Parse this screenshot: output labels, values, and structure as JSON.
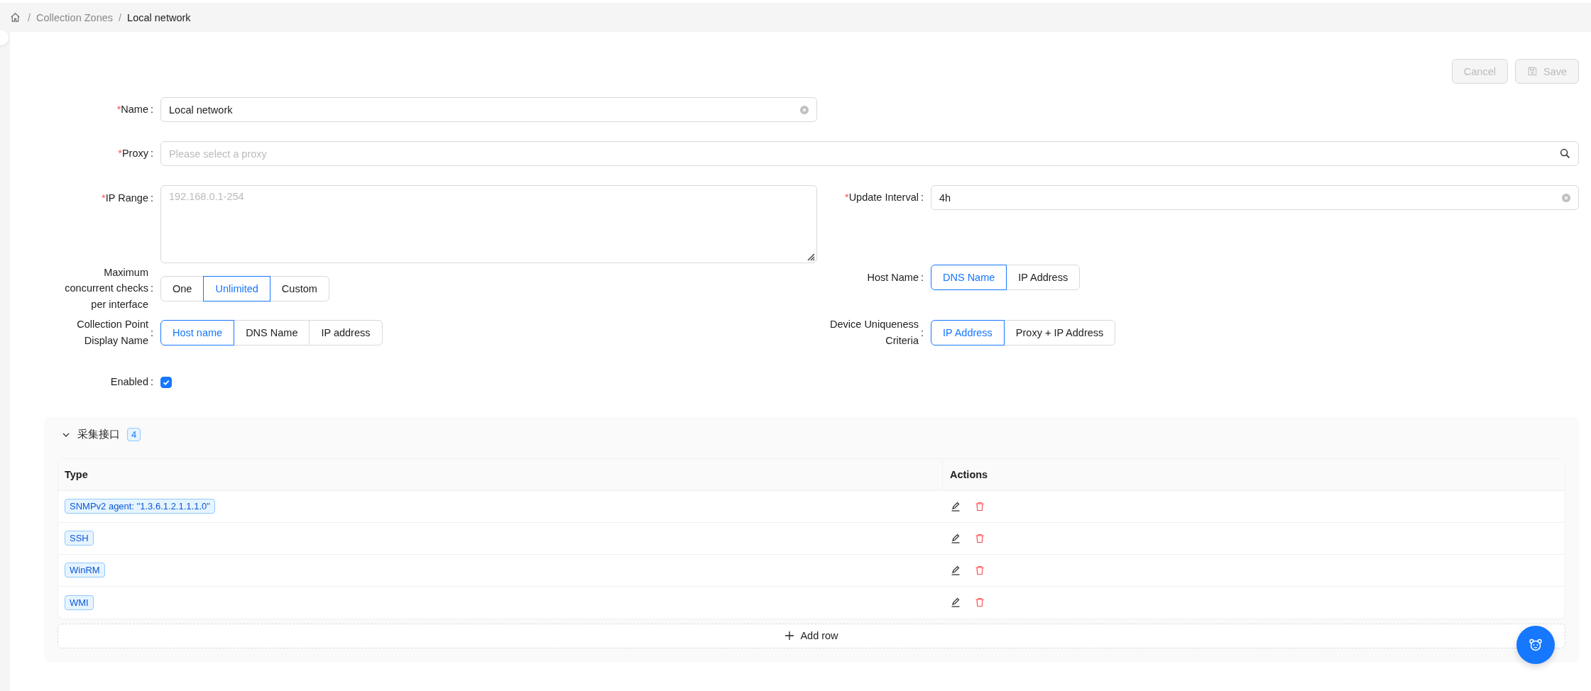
{
  "breadcrumb": [
    {
      "label": "Collection Zones",
      "current": false
    },
    {
      "label": "Local network",
      "current": true
    }
  ],
  "breadcrumb_separator": "/",
  "toolbar": [
    {
      "kind": "cancel",
      "label": "Cancel",
      "disabled": true
    },
    {
      "kind": "save",
      "label": "Save",
      "disabled": true
    }
  ],
  "form": {
    "required_mark": "*",
    "label_suffix": ":",
    "rows": [
      {
        "fields": [
          {
            "kind": "text",
            "label": "Name",
            "required": true,
            "value": "Local network",
            "clearable": true
          }
        ]
      },
      {
        "full": true,
        "fields": [
          {
            "kind": "search",
            "label": "Proxy",
            "required": true,
            "placeholder": "Please select a proxy"
          }
        ]
      },
      {
        "fields": [
          {
            "kind": "textarea",
            "label": "IP Range",
            "required": true,
            "placeholder": "192.168.0.1-254"
          },
          {
            "kind": "text",
            "label": "Update Interval",
            "required": true,
            "value": "4h",
            "clearable": true
          }
        ]
      },
      {
        "fields": [
          {
            "kind": "segmented",
            "label": "Maximum concurrent checks per interface",
            "required": false,
            "options": [
              {
                "label": "One",
                "selected": false
              },
              {
                "label": "Unlimited",
                "selected": true
              },
              {
                "label": "Custom",
                "selected": false
              }
            ]
          },
          {
            "kind": "segmented",
            "label": "Host Name",
            "required": false,
            "options": [
              {
                "label": "DNS Name",
                "selected": true
              },
              {
                "label": "IP Address",
                "selected": false
              }
            ]
          }
        ]
      },
      {
        "fields": [
          {
            "kind": "segmented",
            "label": "Collection Point Display Name",
            "required": false,
            "options": [
              {
                "label": "Host name",
                "selected": true
              },
              {
                "label": "DNS Name",
                "selected": false
              },
              {
                "label": "IP address",
                "selected": false
              }
            ]
          },
          {
            "kind": "segmented",
            "label": "Device Uniqueness Criteria",
            "required": false,
            "options": [
              {
                "label": "IP Address",
                "selected": true
              },
              {
                "label": "Proxy + IP Address",
                "selected": false
              }
            ]
          }
        ]
      },
      {
        "fields": [
          {
            "kind": "checkbox",
            "label": "Enabled",
            "required": false,
            "checked": true
          }
        ]
      }
    ]
  },
  "panel": {
    "title": "采集接口",
    "count": "4",
    "expanded": true,
    "table": {
      "columns": [
        "Type",
        "Actions"
      ],
      "rows": [
        {
          "type": "SNMPv2 agent: \"1.3.6.1.2.1.1.1.0\""
        },
        {
          "type": "SSH"
        },
        {
          "type": "WinRM"
        },
        {
          "type": "WMI"
        }
      ]
    },
    "add_row": "Add row"
  }
}
